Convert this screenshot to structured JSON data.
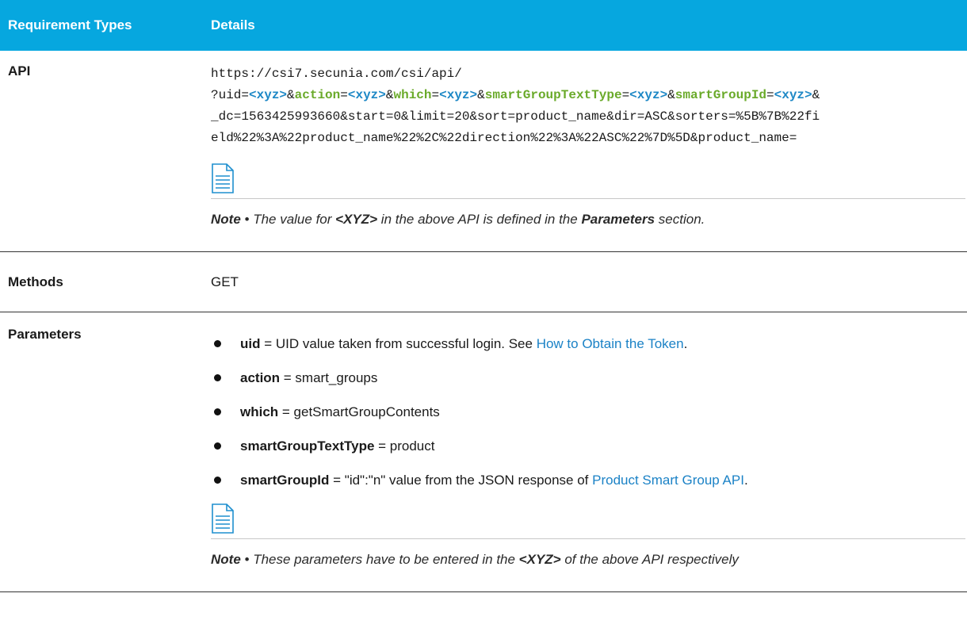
{
  "header": {
    "col1": "Requirement Types",
    "col2": "Details"
  },
  "api": {
    "label": "API",
    "line1": "https://csi7.secunia.com/csi/api/",
    "line2": {
      "p1": "?uid=",
      "v1": "<xyz>",
      "p2": "&",
      "k2": "action",
      "e2": "=",
      "v2": "<xyz>",
      "p3": "&",
      "k3": "which",
      "e3": "=",
      "v3": "<xyz>",
      "p4": "&",
      "k4": "smartGroupTextType",
      "e4": "=",
      "v4": "<xyz>",
      "p5": "&",
      "k5": "smartGroupId",
      "e5": "=",
      "v5": "<xyz>",
      "p6": "&"
    },
    "line3": "_dc=1563425993660&start=0&limit=20&sort=product_name&dir=ASC&sorters=%5B%7B%22fi",
    "line4": "eld%22%3A%22product_name%22%2C%22direction%22%3A%22ASC%22%7D%5D&product_name=",
    "note": {
      "lead": "Note",
      "sep": " • ",
      "t1": "The value for ",
      "b1": "<XYZ>",
      "t2": " in the above API is defined in the ",
      "b2": "Parameters",
      "t3": " section."
    }
  },
  "methods": {
    "label": "Methods",
    "value": "GET"
  },
  "parameters": {
    "label": "Parameters",
    "items": [
      {
        "name": "uid",
        "text": " = UID value taken from successful login. See ",
        "link": "How to Obtain the Token",
        "tail": "."
      },
      {
        "name": "action",
        "text": " = smart_groups",
        "link": "",
        "tail": ""
      },
      {
        "name": "which",
        "text": " = getSmartGroupContents",
        "link": "",
        "tail": ""
      },
      {
        "name": "smartGroupTextType",
        "text": " = product",
        "link": "",
        "tail": ""
      },
      {
        "name": "smartGroupId",
        "text": " = \"id\":\"n\" value from the JSON response of ",
        "link": "Product Smart Group API",
        "tail": "."
      }
    ],
    "note": {
      "lead": "Note",
      "sep": " • ",
      "t1": "These parameters have to be entered in the ",
      "b1": "<XYZ>",
      "t2": " of the above API respectively"
    }
  }
}
